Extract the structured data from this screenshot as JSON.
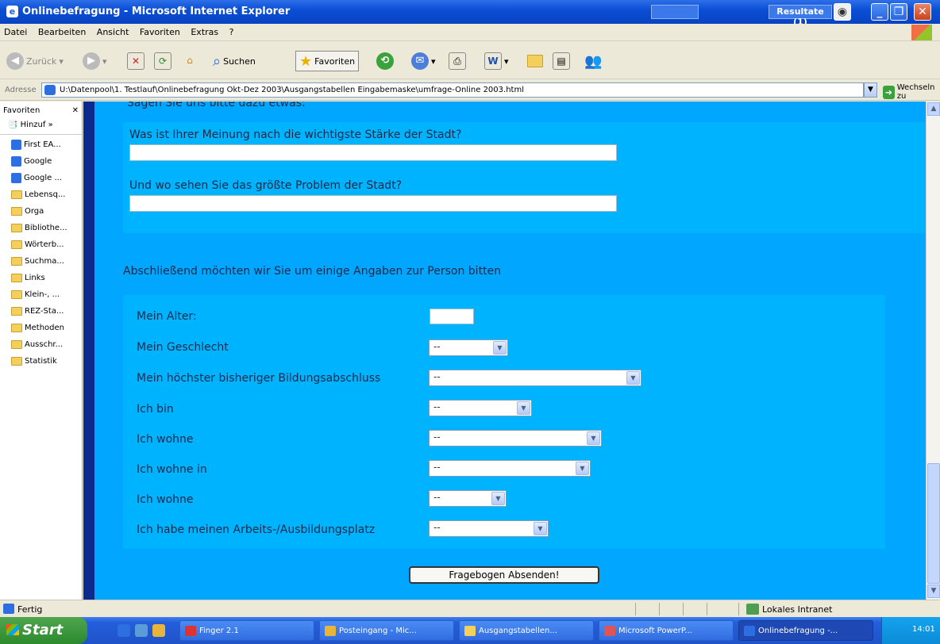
{
  "window": {
    "title": "Onlinebefragung - Microsoft Internet Explorer",
    "tb_search_text": "",
    "tb_results": "Resultate (1)"
  },
  "menu": [
    "Datei",
    "Bearbeiten",
    "Ansicht",
    "Favoriten",
    "Extras",
    "?"
  ],
  "toolbar": {
    "back": "Zurück",
    "search": "Suchen",
    "favorites": "Favoriten"
  },
  "address": {
    "label": "Adresse",
    "url": "U:\\Datenpool\\1. Testlauf\\Onlinebefragung Okt-Dez 2003\\Ausgangstabellen Eingabemaske\\umfrage-Online 2003.html",
    "go": "Wechseln zu"
  },
  "sidebar": {
    "title": "Favoriten",
    "add": "Hinzuf",
    "items": [
      {
        "label": "First EA...",
        "type": "page"
      },
      {
        "label": "Google",
        "type": "page"
      },
      {
        "label": "Google ...",
        "type": "page"
      },
      {
        "label": "Lebensq...",
        "type": "folder"
      },
      {
        "label": "Orga",
        "type": "folder"
      },
      {
        "label": "Bibliothe...",
        "type": "folder"
      },
      {
        "label": "Wörterb...",
        "type": "folder"
      },
      {
        "label": "Suchma...",
        "type": "folder"
      },
      {
        "label": "Links",
        "type": "folder"
      },
      {
        "label": "Klein-, ...",
        "type": "folder"
      },
      {
        "label": "REZ-Sta...",
        "type": "folder"
      },
      {
        "label": "Methoden",
        "type": "folder"
      },
      {
        "label": "Ausschr...",
        "type": "folder"
      },
      {
        "label": "Statistik",
        "type": "folder"
      }
    ]
  },
  "form": {
    "cut_heading": "Sagen Sie uns bitte dazu etwas:",
    "q1": "Was ist Ihrer Meinung nach die wichtigste Stärke der Stadt?",
    "q2": "Und wo sehen Sie das größte Problem der Stadt?",
    "intro": "Abschließend möchten wir Sie um einige Angaben zur Person bitten",
    "rows": [
      {
        "label": "Mein Alter:",
        "value": ""
      },
      {
        "label": "Mein Geschlecht",
        "value": "--"
      },
      {
        "label": "Mein höchster bisheriger Bildungsabschluss",
        "value": "--"
      },
      {
        "label": "Ich bin",
        "value": "--"
      },
      {
        "label": "Ich wohne",
        "value": "--"
      },
      {
        "label": "Ich wohne in",
        "value": "--"
      },
      {
        "label": "Ich wohne",
        "value": "--"
      },
      {
        "label": "Ich habe meinen Arbeits-/Ausbildungsplatz",
        "value": "--"
      }
    ],
    "submit": "Fragebogen Absenden!"
  },
  "status": {
    "text": "Fertig",
    "zone": "Lokales Intranet"
  },
  "taskbar": {
    "start": "Start",
    "tasks": [
      {
        "label": "Finger 2.1",
        "color": "#d33"
      },
      {
        "label": "Posteingang - Mic...",
        "color": "#e9b43a"
      },
      {
        "label": "Ausgangstabellen...",
        "color": "#f3cf5c"
      },
      {
        "label": "Microsoft PowerP...",
        "color": "#d55"
      },
      {
        "label": "Onlinebefragung -...",
        "color": "#2d6ee0"
      }
    ],
    "clock": "14:01"
  }
}
